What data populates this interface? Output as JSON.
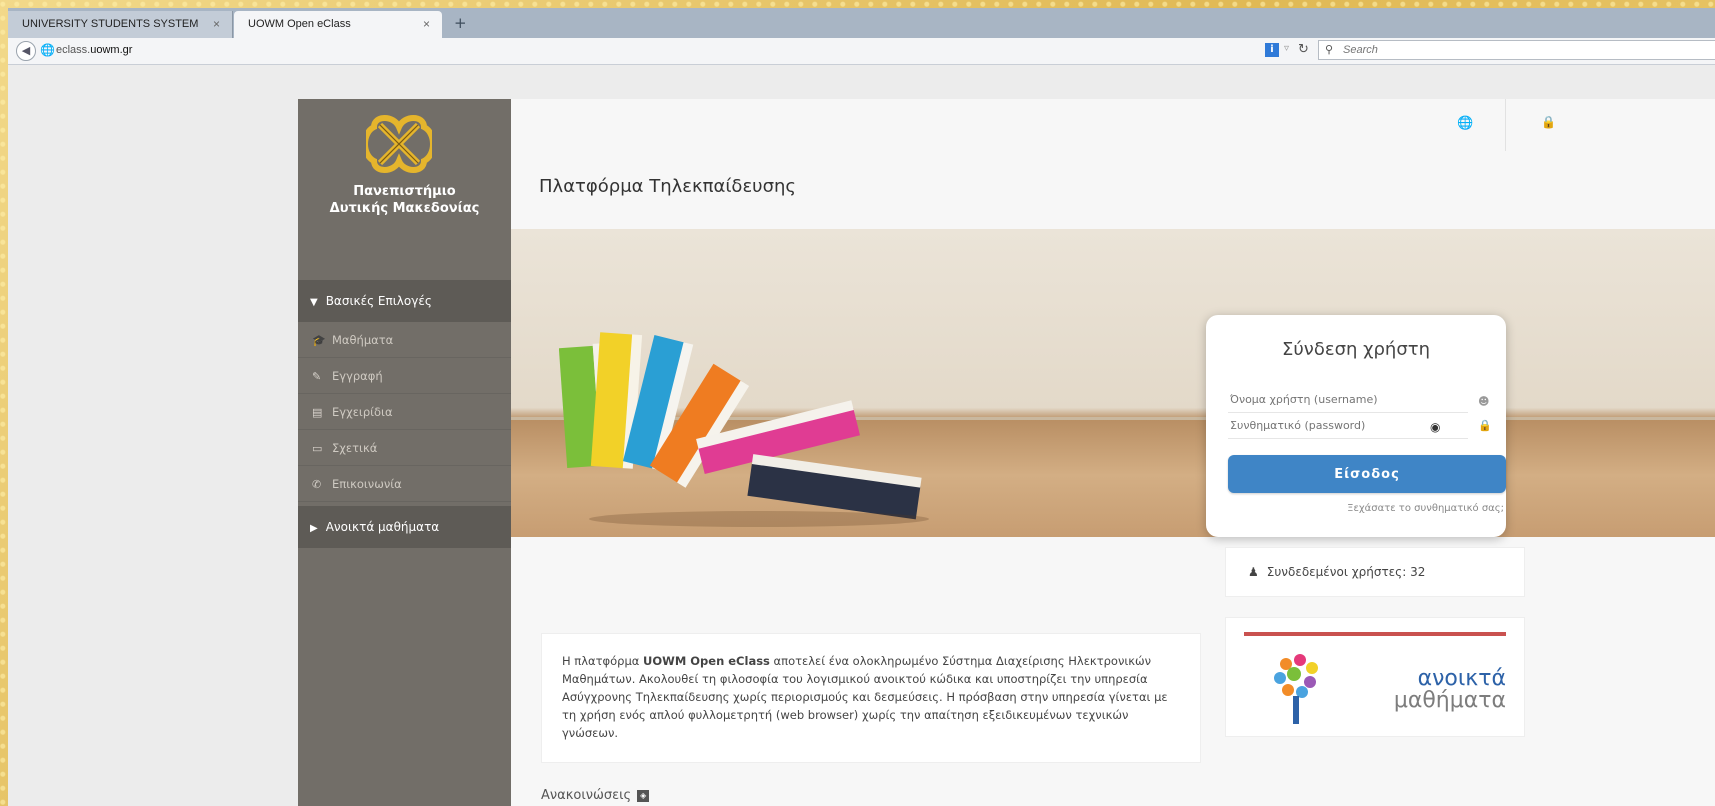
{
  "browser": {
    "tabs": [
      {
        "label": "UNIVERSITY STUDENTS SYSTEM",
        "active": false
      },
      {
        "label": "UOWM Open eClass",
        "active": true
      }
    ],
    "tab_close_glyph": "×",
    "new_tab_glyph": "+",
    "url_prefix": "eclass.",
    "url_domain": "uowm.gr",
    "search_placeholder": "Search"
  },
  "sidebar": {
    "university_line1": "Πανεπιστήμιο",
    "university_line2": "Δυτικής Μακεδονίας",
    "section_main": "Βασικές Επιλογές",
    "items": [
      {
        "label": "Μαθήματα",
        "icon": "graduation-cap-icon"
      },
      {
        "label": "Εγγραφή",
        "icon": "edit-icon"
      },
      {
        "label": "Εγχειρίδια",
        "icon": "document-icon"
      },
      {
        "label": "Σχετικά",
        "icon": "credit-card-icon"
      },
      {
        "label": "Επικοινωνία",
        "icon": "phone-icon"
      }
    ],
    "section_open": "Ανοικτά μαθήματα"
  },
  "main": {
    "title": "Πλατφόρμα Τηλεκπαίδευσης",
    "description_prefix": "Η πλατφόρμα ",
    "description_bold": "UOWM Open eClass",
    "description_rest": " αποτελεί ένα ολοκληρωμένο Σύστημα Διαχείρισης Ηλεκτρονικών Μαθημάτων. Ακολουθεί τη φιλοσοφία του λογισμικού ανοικτού κώδικα και υποστηρίζει την υπηρεσία Ασύγχρονης Τηλεκπαίδευσης χωρίς περιορισμούς και δεσμεύσεις. Η πρόσβαση στην υπηρεσία γίνεται με τη χρήση ενός απλού φυλλομετρητή (web browser) χωρίς την απαίτηση εξειδικευμένων τεχνικών γνώσεων.",
    "announcements": "Ανακοινώσεις"
  },
  "login": {
    "title": "Σύνδεση χρήστη",
    "username_placeholder": "Όνομα χρήστη (username)",
    "password_placeholder": "Συνθηματικό (password)",
    "submit": "Είσοδος",
    "forgot": "Ξεχάσατε το συνθηματικό σας;"
  },
  "side_panels": {
    "online_users": "Συνδεδεμένοι χρήστες: 32",
    "open_courses_line1": "ανοικτά",
    "open_courses_line2": "μαθήματα"
  },
  "colors": {
    "sidebar_bg": "#726e68",
    "login_button": "#3f85c6",
    "brand_blue": "#2d62a8"
  }
}
